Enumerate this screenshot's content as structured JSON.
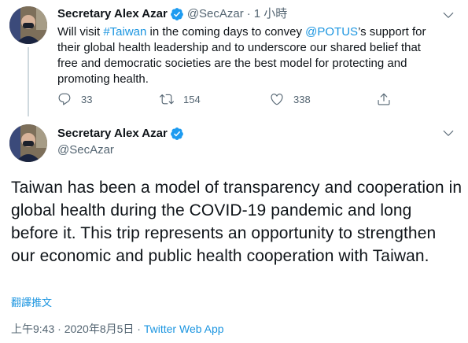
{
  "tweet1": {
    "name": "Secretary Alex Azar",
    "handle": "@SecAzar",
    "separator": "·",
    "time": "1 小時",
    "text_parts": {
      "p1": "Will visit ",
      "hashtag": "#Taiwan",
      "p2": " in the coming days to convey ",
      "mention": "@POTUS",
      "p3": "’s support for their global health leadership and to underscore our shared belief that free and democratic societies are the best model for protecting and promoting health."
    },
    "actions": {
      "reply_count": "33",
      "retweet_count": "154",
      "like_count": "338"
    }
  },
  "tweet2": {
    "name": "Secretary Alex Azar",
    "handle": "@SecAzar",
    "text": "Taiwan has been a model of transparency and cooperation in global health during the COVID-19 pandemic and long before it. This trip represents an opportunity to strengthen our economic and public health cooperation with Taiwan.",
    "translate_label": "翻譯推文",
    "timestamp": "上午9:43 · 2020年8月5日",
    "separator": "·",
    "source": "Twitter Web App"
  },
  "colors": {
    "link": "#1b95e0",
    "muted": "#536471",
    "verified": "#1d9bf0",
    "text": "#0f1419"
  },
  "icons": [
    "verified-badge-icon",
    "chevron-down-icon",
    "reply-icon",
    "retweet-icon",
    "like-icon",
    "share-icon"
  ]
}
